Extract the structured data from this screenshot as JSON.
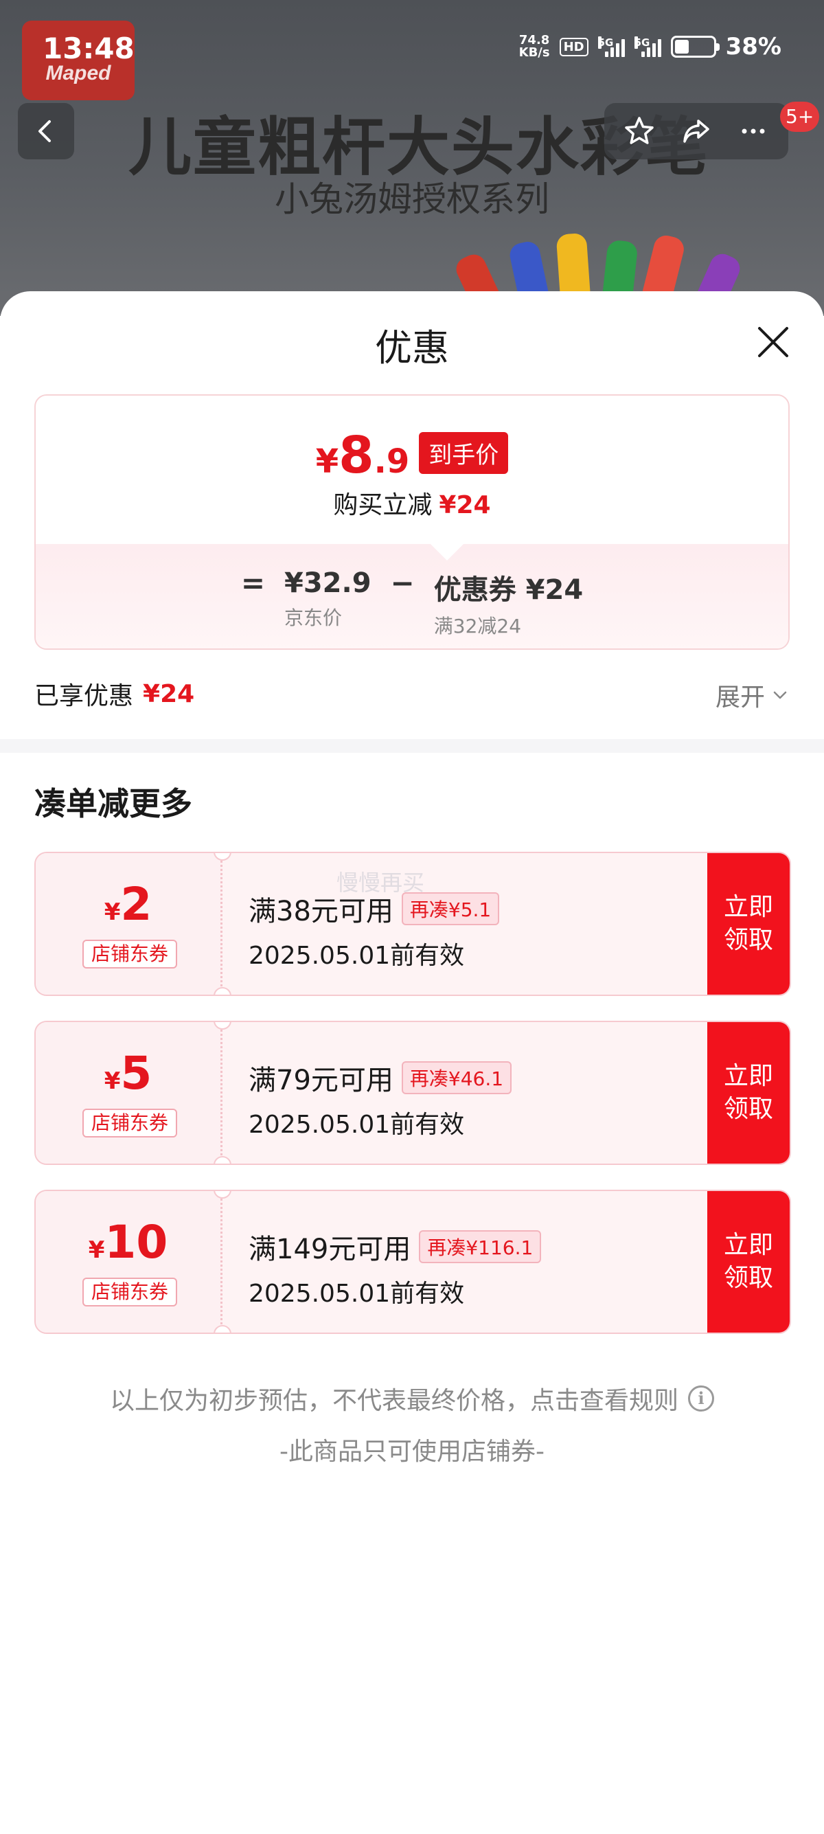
{
  "status_bar": {
    "time": "13:48",
    "net_speed_value": "74.8",
    "net_speed_unit": "KB/s",
    "hd": "HD",
    "sim1": "5G",
    "sim2": "5G",
    "battery_level": 0.38,
    "battery_percent": "38%"
  },
  "product_banner": {
    "brand": "Maped",
    "title": "儿童粗杆大头水彩笔",
    "subtitle": "小兔汤姆授权系列"
  },
  "top_nav": {
    "back_icon": "chevron-left-icon",
    "favorite_icon": "star-icon",
    "share_icon": "share-icon",
    "more_icon": "more-icon",
    "message_badge": "5+"
  },
  "sheet": {
    "title": "优惠",
    "close_icon": "close-icon",
    "final_price": {
      "currency": "¥",
      "integer": "8",
      "decimal": ".9",
      "tag": "到手价"
    },
    "reduce_label": "购买立减",
    "reduce_amount": "¥24",
    "formula": {
      "equals": "=",
      "minus": "−",
      "jd_price": "¥32.9",
      "jd_price_label": "京东价",
      "coupon_value": "优惠券 ¥24",
      "coupon_rule": "满32减24"
    },
    "enjoyed_label": "已享优惠",
    "enjoyed_amount": "¥24",
    "expand_label": "展开",
    "more_title": "凑单减更多",
    "watermark": "慢慢再买",
    "coupons": [
      {
        "currency": "¥",
        "amount": "2",
        "type": "店铺东券",
        "condition": "满38元可用",
        "add_more": "再凑¥5.1",
        "valid": "2025.05.01前有效",
        "button": "立即领取"
      },
      {
        "currency": "¥",
        "amount": "5",
        "type": "店铺东券",
        "condition": "满79元可用",
        "add_more": "再凑¥46.1",
        "valid": "2025.05.01前有效",
        "button": "立即领取"
      },
      {
        "currency": "¥",
        "amount": "10",
        "type": "店铺东券",
        "condition": "满149元可用",
        "add_more": "再凑¥116.1",
        "valid": "2025.05.01前有效",
        "button": "立即领取"
      }
    ],
    "note": "以上仅为初步预估，不代表最终价格，点击查看规则",
    "note_shop_only": "-此商品只可使用店铺券-"
  },
  "colors": {
    "accent_red": "#e4161e",
    "button_red": "#f2121d",
    "coupon_bg": "#fef3f4"
  }
}
